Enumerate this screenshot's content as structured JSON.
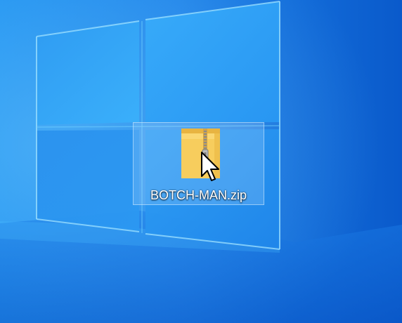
{
  "desktop": {
    "wallpaper": "windows-10-logo-wallpaper",
    "icons": [
      {
        "label": "BOTCH-MAN.zip",
        "icon": "zip-folder-icon",
        "selected": true
      }
    ]
  },
  "cursor": {
    "type": "arrow-pointer-icon"
  },
  "colors": {
    "background": "#0e6fe0",
    "pane_light": "#3aa6f6",
    "folder_yellow": "#f7cd5d",
    "selection_border": "#d7eeff"
  }
}
